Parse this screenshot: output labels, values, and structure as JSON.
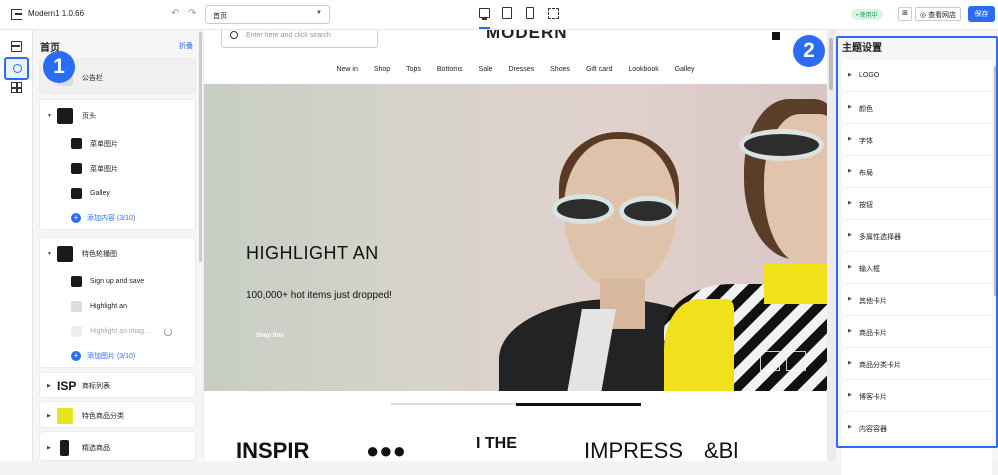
{
  "topbar": {
    "app_title": "Modern1 1.0.66",
    "page_select": "首页",
    "status_badge": "• 使用中",
    "view_store": "查看网店",
    "save_label": "保存"
  },
  "panel": {
    "title": "首页",
    "collapse": "折叠",
    "announcement": "公告栏",
    "header": "页头",
    "header_items": [
      "菜单图片",
      "菜单图片",
      "Galley"
    ],
    "header_add": "添加内容 (3/10)",
    "carousel": "特色轮播图",
    "carousel_items": [
      "Sign up and save",
      "Highlight an",
      "Highlight an imag..."
    ],
    "carousel_add": "添加图片 (3/10)",
    "brand_list_logo": "ISP",
    "brand_list": "商标列表",
    "featured_category": "特色商品分类",
    "featured_products": "精选商品"
  },
  "badges": {
    "one": "1",
    "two": "2"
  },
  "store": {
    "search_placeholder": "Enter here and click search",
    "logo": "MODERN",
    "nav": [
      "New in",
      "Shop",
      "Tops",
      "Bottoms",
      "Sale",
      "Dresses",
      "Shoes",
      "Gift card",
      "Lookbook",
      "Galley"
    ],
    "hero_title": "HIGHLIGHT AN",
    "hero_subtitle": "100,000+ hot items just dropped!",
    "hero_button": "Shop this",
    "brands": [
      "INSPIR",
      "●●●",
      "I THE",
      "IMPRESS",
      "&Bl"
    ]
  },
  "theme": {
    "title": "主题设置",
    "items": [
      "LOGO",
      "颜色",
      "字体",
      "布局",
      "按钮",
      "多属性选择器",
      "输入框",
      "其他卡片",
      "商品卡片",
      "商品分类卡片",
      "博客卡片",
      "内容容器"
    ]
  },
  "colors": {
    "accent": "#2a6df4",
    "status_green": "#1aa05a"
  }
}
